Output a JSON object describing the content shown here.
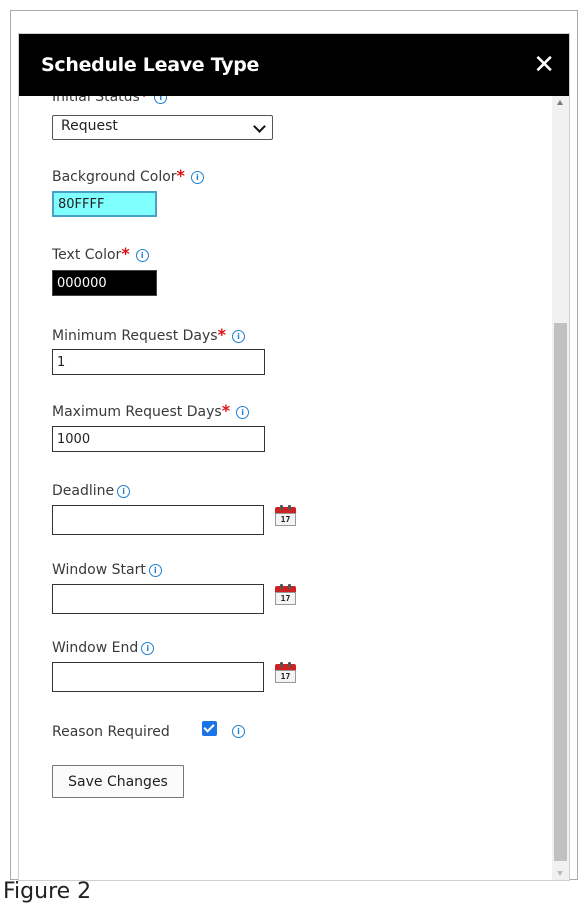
{
  "dialog": {
    "title": "Schedule Leave Type",
    "close_icon": "close-x-icon"
  },
  "fields": {
    "initial_status": {
      "label": "Initial Status",
      "value": "Request"
    },
    "background_color": {
      "label": "Background Color",
      "value": "80FFFF",
      "swatch": "#80FFFF"
    },
    "text_color": {
      "label": "Text Color",
      "value": "000000",
      "swatch": "#000000"
    },
    "min_request_days": {
      "label": "Minimum Request Days",
      "value": "1"
    },
    "max_request_days": {
      "label": "Maximum Request Days",
      "value": "1000"
    },
    "deadline": {
      "label": "Deadline",
      "value": ""
    },
    "window_start": {
      "label": "Window Start",
      "value": ""
    },
    "window_end": {
      "label": "Window End",
      "value": ""
    },
    "reason_required": {
      "label": "Reason Required",
      "checked": true
    }
  },
  "required_marker": "*",
  "info_glyph": "i",
  "calendar_day": "17",
  "save_button": "Save Changes",
  "caption": "Figure 2",
  "colors": {
    "titlebar": "#000000",
    "required": "#e01010",
    "info": "#1e7fd0",
    "checkbox": "#1a73e8"
  }
}
